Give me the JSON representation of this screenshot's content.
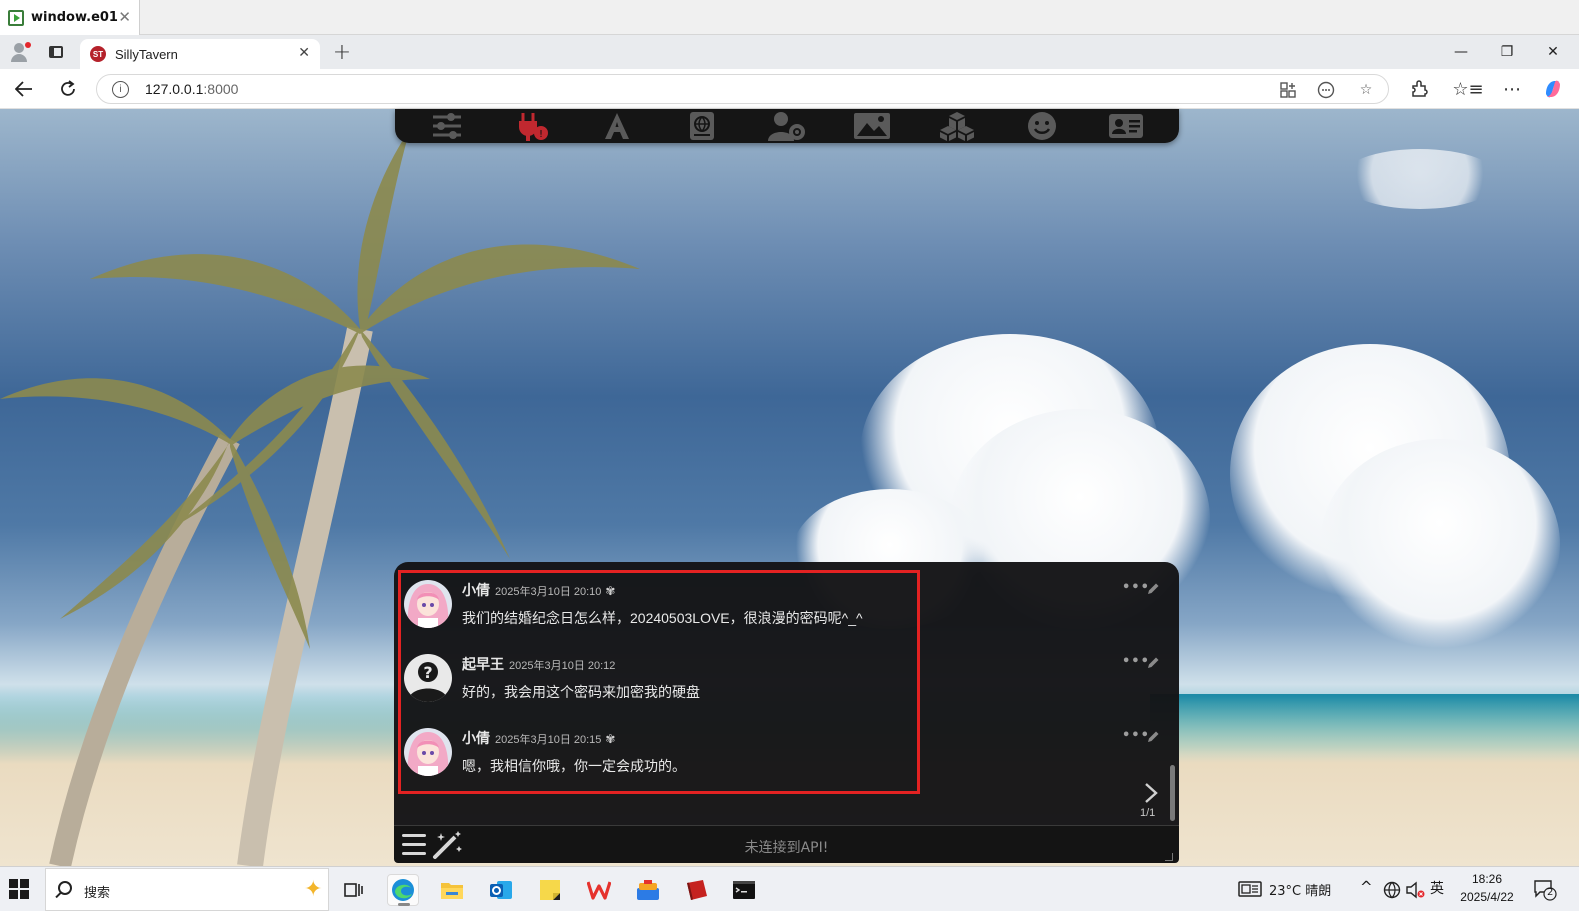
{
  "os_window": {
    "title": "window.e01"
  },
  "browser": {
    "tab_title": "SillyTavern",
    "tab_favicon": "ST",
    "url_host": "127.0.0.1",
    "url_port": ":8000"
  },
  "st_nav": [
    "ai-response-config-icon",
    "api-connections-icon",
    "ai-text-formatting-icon",
    "world-info-icon",
    "user-settings-icon",
    "backgrounds-icon",
    "extensions-icon",
    "persona-icon",
    "character-management-icon"
  ],
  "chat": {
    "messages": [
      {
        "name": "小倩",
        "timestamp": "2025年3月10日 20:10",
        "text": "我们的结婚纪念日怎么样，20240503LOVE，很浪漫的密码呢^_^",
        "avatar": "anime-girl-avatar",
        "is_bot": true
      },
      {
        "name": "起早王",
        "timestamp": "2025年3月10日 20:12",
        "text": "好的，我会用这个密码来加密我的硬盘",
        "avatar": "default-user-avatar",
        "is_bot": false
      },
      {
        "name": "小倩",
        "timestamp": "2025年3月10日 20:15",
        "text": "嗯，我相信你哦，你一定会成功的。",
        "avatar": "anime-girl-avatar",
        "is_bot": true
      }
    ],
    "swipe_counter": "1/1",
    "input_placeholder": "未连接到API!"
  },
  "colors": {
    "highlight_border": "#e32222",
    "panel_bg": "#141416",
    "accent_red": "#c0282f"
  },
  "taskbar": {
    "search_label": "搜索",
    "weather": "23°C 晴朗",
    "ime": "英",
    "time": "18:26",
    "date": "2025/4/22",
    "notifications": "2"
  }
}
